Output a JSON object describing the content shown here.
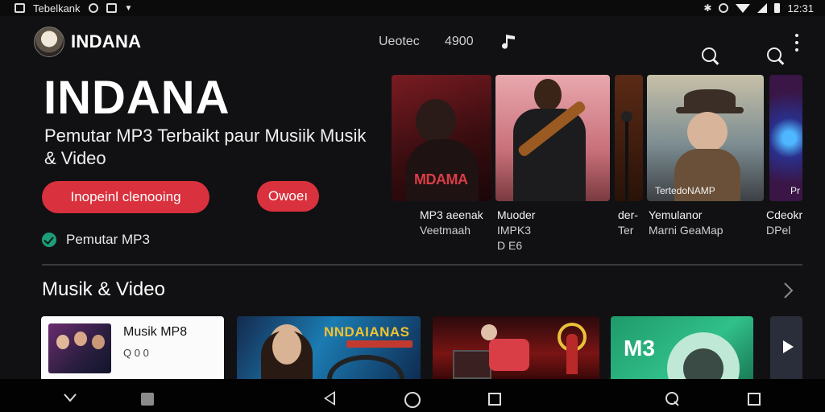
{
  "status_bar": {
    "app_label": "Tebelkank",
    "time": "12:31"
  },
  "header": {
    "brand": "INDANA",
    "link_1": "Ueotec",
    "link_2": "4900"
  },
  "hero": {
    "title": "INDANA",
    "subtitle": "Pemutar MP3 Terbaikt paur Musiik Musik & Video",
    "primary_button": "Inopeinl clenooing",
    "secondary_button": "Owoeı",
    "check_label": "Pemutar MP3"
  },
  "carousel": [
    {
      "image_label": "MDAMA",
      "caption_1": "MP3 aeenak",
      "caption_2": "Veetmaah",
      "caption_3": ""
    },
    {
      "image_label": "",
      "caption_1": "Muoder",
      "caption_2": "IMPK3",
      "caption_3": "D E6"
    },
    {
      "image_label": "",
      "caption_1": "der-",
      "caption_2": "Ter",
      "caption_3": ""
    },
    {
      "image_label": "TertedoNAMP",
      "caption_1": "Yemulanor",
      "caption_2": "Marni GeaMap",
      "caption_3": ""
    },
    {
      "image_label": "Pr",
      "caption_1": "Cdeokr",
      "caption_2": "DPel",
      "caption_3": ""
    }
  ],
  "section": {
    "title": "Musik & Video"
  },
  "tiles": [
    {
      "title": "Musik MP8",
      "meta": "Q 0 0"
    },
    {
      "title": "NNDAIANAS"
    },
    {
      "title": ""
    },
    {
      "title": "M3"
    },
    {
      "title": ""
    }
  ],
  "colors": {
    "accent_red": "#d9313d",
    "check_green": "#1d9e7a",
    "background": "#111113"
  },
  "icons": [
    "search-icon",
    "more-icon",
    "music-note-icon",
    "chevron-right-icon",
    "play-icon",
    "back-icon",
    "home-icon",
    "recents-icon"
  ]
}
